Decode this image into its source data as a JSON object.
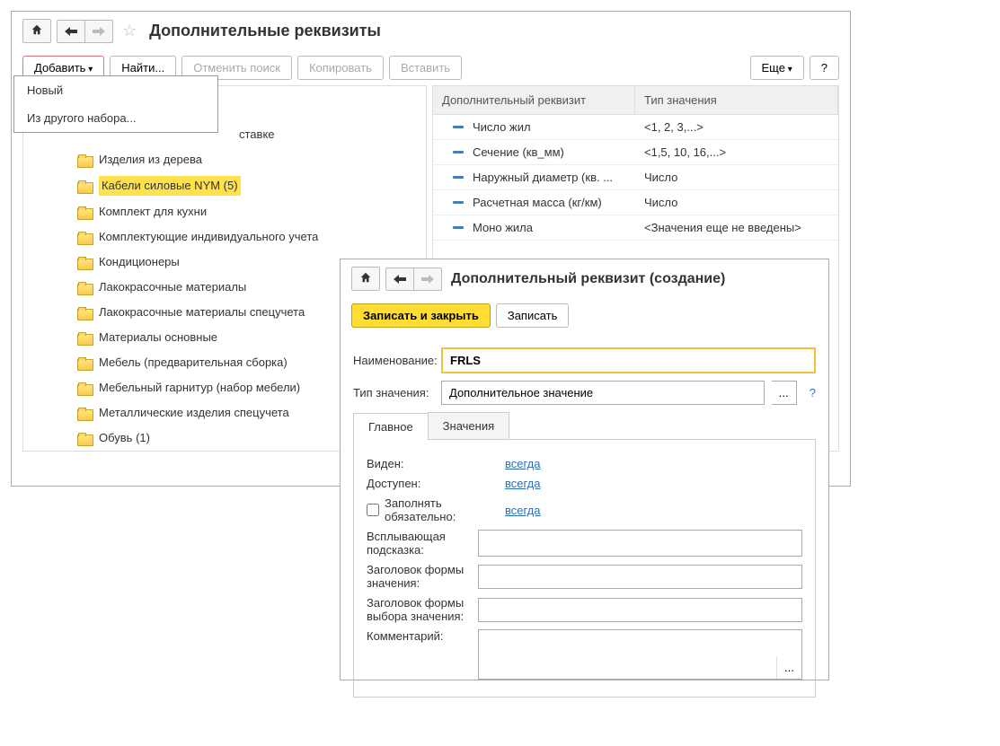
{
  "main": {
    "title": "Дополнительные реквизиты",
    "toolbar": {
      "add": "Добавить",
      "find": "Найти...",
      "cancel_search": "Отменить поиск",
      "copy": "Копировать",
      "paste": "Вставить",
      "more": "Еще",
      "help": "?"
    },
    "dropdown": {
      "new": "Новый",
      "from_other": "Из другого набора..."
    },
    "tree": {
      "partial_item": "ставке",
      "items": [
        "Изделия из дерева",
        "Кабели силовые NYM (5)",
        "Комплект для кухни",
        "Комплектующие индивидуального учета",
        "Кондиционеры",
        "Лакокрасочные материалы",
        "Лакокрасочные материалы спецучета",
        "Материалы основные",
        "Мебель (предварительная сборка)",
        "Мебельный гарнитур (набор мебели)",
        "Металлические изделия спецучета",
        "Обувь (1)"
      ],
      "highlight_index": 1
    },
    "grid": {
      "headers": {
        "attr": "Дополнительный реквизит",
        "type": "Тип значения"
      },
      "rows": [
        {
          "attr": "Число жил",
          "type": "<1, 2, 3,...>"
        },
        {
          "attr": "Сечение (кв_мм)",
          "type": "<1,5, 10, 16,...>"
        },
        {
          "attr": "Наружный диаметр (кв. ...",
          "type": "Число"
        },
        {
          "attr": "Расчетная масса (кг/км)",
          "type": "Число"
        },
        {
          "attr": "Моно жила",
          "type": "<Значения еще не введены>"
        }
      ]
    }
  },
  "detail": {
    "title": "Дополнительный реквизит (создание)",
    "toolbar": {
      "save_close": "Записать и закрыть",
      "save": "Записать"
    },
    "fields": {
      "name_label": "Наименование:",
      "name_value": "FRLS",
      "type_label": "Тип значения:",
      "type_value": "Дополнительное значение",
      "type_sel": "...",
      "type_help": "?"
    },
    "tabs": {
      "main": "Главное",
      "values": "Значения"
    },
    "props": {
      "visible_label": "Виден:",
      "visible_value": "всегда",
      "available_label": "Доступен:",
      "available_value": "всегда",
      "required_label": "Заполнять обязательно:",
      "required_value": "всегда",
      "tooltip_label": "Всплывающая подсказка:",
      "tooltip_value": "",
      "form_title_label": "Заголовок формы значения:",
      "form_title_value": "",
      "choice_title_label": "Заголовок формы выбора значения:",
      "choice_title_value": "",
      "comment_label": "Комментарий:",
      "comment_value": "",
      "comment_sel": "..."
    }
  }
}
